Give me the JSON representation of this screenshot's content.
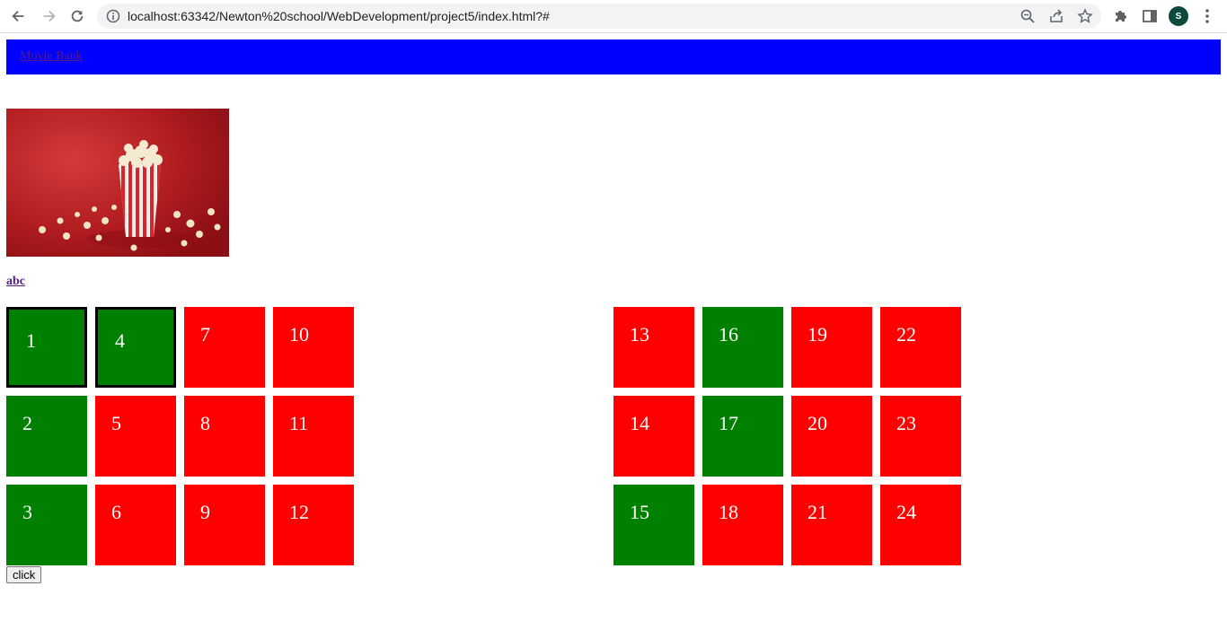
{
  "browser": {
    "url": "localhost:63342/Newton%20school/WebDevelopment/project5/index.html?#",
    "profile_initial": "S"
  },
  "navbar": {
    "color": "#0000ff",
    "link_label": "Movie Bank"
  },
  "hero": {
    "image": "popcorn-photo"
  },
  "abc_link": "abc",
  "grids": [
    {
      "tiles": [
        {
          "number": "1",
          "color": "green",
          "selected": true
        },
        {
          "number": "2",
          "color": "green"
        },
        {
          "number": "3",
          "color": "green"
        },
        {
          "number": "4",
          "color": "green",
          "selected": true
        },
        {
          "number": "5",
          "color": "red"
        },
        {
          "number": "6",
          "color": "red"
        },
        {
          "number": "7",
          "color": "red"
        },
        {
          "number": "8",
          "color": "red"
        },
        {
          "number": "9",
          "color": "red"
        },
        {
          "number": "10",
          "color": "red"
        },
        {
          "number": "11",
          "color": "red"
        },
        {
          "number": "12",
          "color": "red"
        }
      ]
    },
    {
      "tiles": [
        {
          "number": "13",
          "color": "red"
        },
        {
          "number": "14",
          "color": "red"
        },
        {
          "number": "15",
          "color": "green"
        },
        {
          "number": "16",
          "color": "green"
        },
        {
          "number": "17",
          "color": "green"
        },
        {
          "number": "18",
          "color": "red"
        },
        {
          "number": "19",
          "color": "red"
        },
        {
          "number": "20",
          "color": "red"
        },
        {
          "number": "21",
          "color": "red"
        },
        {
          "number": "22",
          "color": "red"
        },
        {
          "number": "23",
          "color": "red"
        },
        {
          "number": "24",
          "color": "red"
        }
      ]
    }
  ],
  "click_button_label": "click",
  "colors": {
    "red": "#ff0000",
    "green": "#008000",
    "selected_border": "#000000"
  }
}
